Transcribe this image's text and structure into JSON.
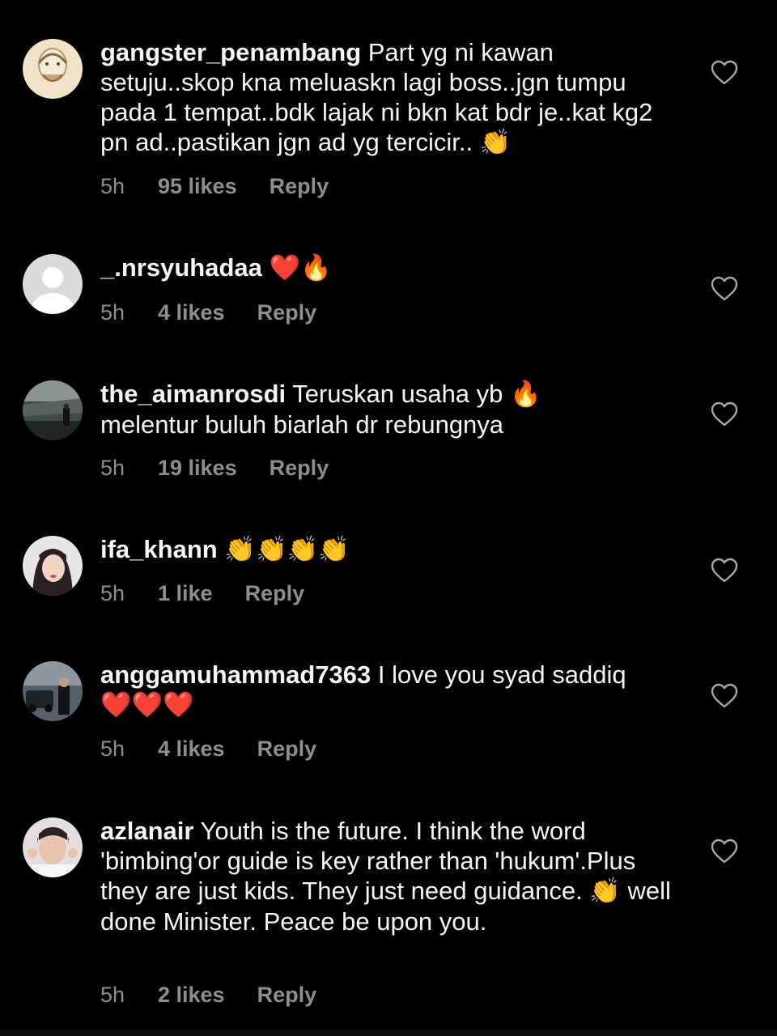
{
  "colors": {
    "background": "#000000",
    "text": "#f5f5f5",
    "meta_text": "#8e8e8e",
    "heart_emoji": "#e0241f",
    "fire_emoji": "#f59a1a",
    "clap_emoji": "#f7c531"
  },
  "comments": [
    {
      "username": "gangster_penambang",
      "text": "Part yg ni kawan setuju..skop kna meluaskn lagi boss..jgn tumpu pada 1 tempat..bdk lajak ni bkn kat bdr je..kat kg2 pn ad..pastikan jgn ad yg tercicir..",
      "emoji": "👏",
      "time": "5h",
      "likes": "95 likes",
      "reply": "Reply",
      "avatar_icon": "cartoon-face-avatar",
      "like_icon": "heart-outline-icon"
    },
    {
      "username": "_.nrsyuhadaa",
      "text": "",
      "emoji": "❤️🔥",
      "time": "5h",
      "likes": "4 likes",
      "reply": "Reply",
      "avatar_icon": "default-person-avatar",
      "like_icon": "heart-outline-icon"
    },
    {
      "username": "the_aimanrosdi",
      "text": "Teruskan usaha yb",
      "emoji": "🔥",
      "text2": "melentur buluh biarlah dr rebungnya",
      "time": "5h",
      "likes": "19 likes",
      "reply": "Reply",
      "avatar_icon": "photo-avatar",
      "like_icon": "heart-outline-icon"
    },
    {
      "username": "ifa_khann",
      "text": "",
      "emoji": "👏👏👏👏",
      "time": "5h",
      "likes": "1 like",
      "reply": "Reply",
      "avatar_icon": "photo-avatar",
      "like_icon": "heart-outline-icon"
    },
    {
      "username": "anggamuhammad7363",
      "text": "I love you syad saddiq",
      "emoji": "❤️❤️❤️",
      "time": "5h",
      "likes": "4 likes",
      "reply": "Reply",
      "avatar_icon": "photo-avatar",
      "like_icon": "heart-outline-icon"
    },
    {
      "username": "azlanair",
      "text": "Youth is the future. I think the word 'bimbing'or guide is key rather than 'hukum'.Plus they are just kids. They just need guidance.",
      "emoji": "👏",
      "text2": "well done Minister. Peace be upon you.",
      "time": "5h",
      "likes": "2 likes",
      "reply": "Reply",
      "avatar_icon": "photo-avatar",
      "like_icon": "heart-outline-icon"
    }
  ]
}
